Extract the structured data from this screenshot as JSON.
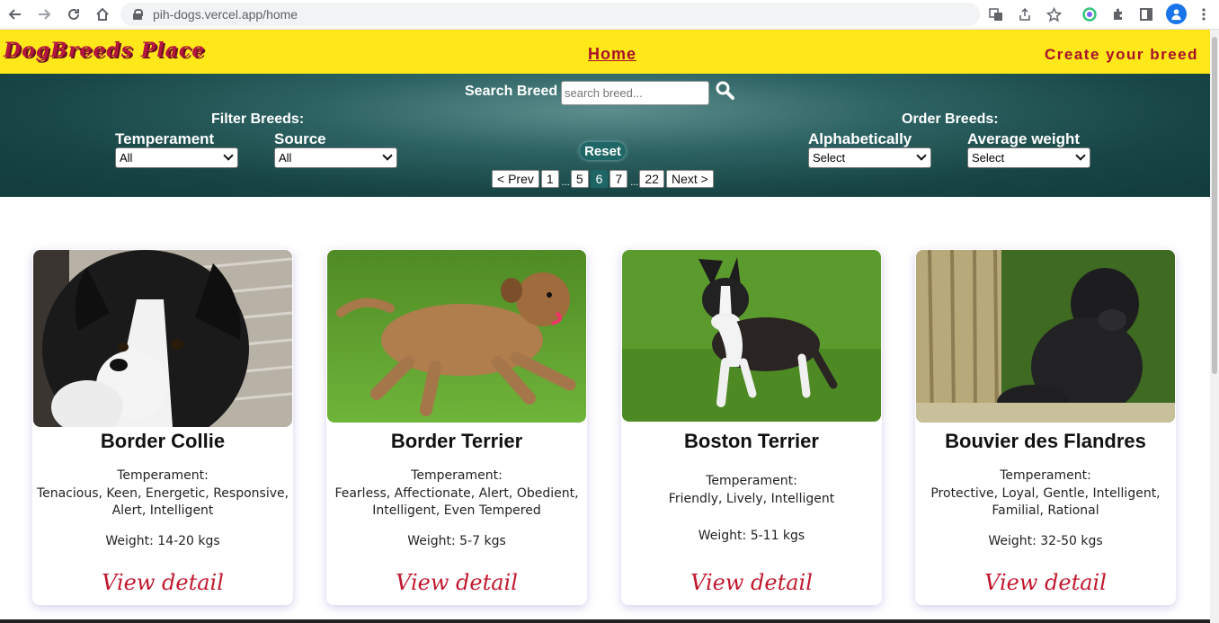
{
  "browser": {
    "url": "pih-dogs.vercel.app/home"
  },
  "header": {
    "logo": "DogBreeds Place",
    "home_label": "Home",
    "create_label": "Create your breed"
  },
  "search": {
    "label": "Search Breed",
    "placeholder": "search breed..."
  },
  "filters": {
    "title": "Filter Breeds:",
    "temperament_label": "Temperament",
    "temperament_value": "All",
    "source_label": "Source",
    "source_value": "All"
  },
  "order": {
    "title": "Order Breeds:",
    "alpha_label": "Alphabetically",
    "alpha_value": "Select",
    "weight_label": "Average weight",
    "weight_value": "Select"
  },
  "reset_label": "Reset",
  "pagination": {
    "prev": "< Prev",
    "first": "1",
    "dots": "...",
    "p5": "5",
    "current": "6",
    "p7": "7",
    "last": "22",
    "next": "Next >"
  },
  "cards": [
    {
      "name": "Border Collie",
      "temperament_label": "Temperament:",
      "temperament": "Tenacious, Keen, Energetic, Responsive, Alert, Intelligent",
      "weight": "Weight: 14-20 kgs",
      "detail": "View detail"
    },
    {
      "name": "Border Terrier",
      "temperament_label": "Temperament:",
      "temperament": "Fearless, Affectionate, Alert, Obedient, Intelligent, Even Tempered",
      "weight": "Weight: 5-7 kgs",
      "detail": "View detail"
    },
    {
      "name": "Boston Terrier",
      "temperament_label": "Temperament:",
      "temperament": "Friendly, Lively, Intelligent",
      "weight": "Weight: 5-11 kgs",
      "detail": "View detail"
    },
    {
      "name": "Bouvier des Flandres",
      "temperament_label": "Temperament:",
      "temperament": "Protective, Loyal, Gentle, Intelligent, Familial, Rational",
      "weight": "Weight: 32-50 kgs",
      "detail": "View detail"
    }
  ],
  "colors": {
    "header_bg": "#ffe81a",
    "brand_red": "#a8102a",
    "panel_teal": "#174444"
  }
}
